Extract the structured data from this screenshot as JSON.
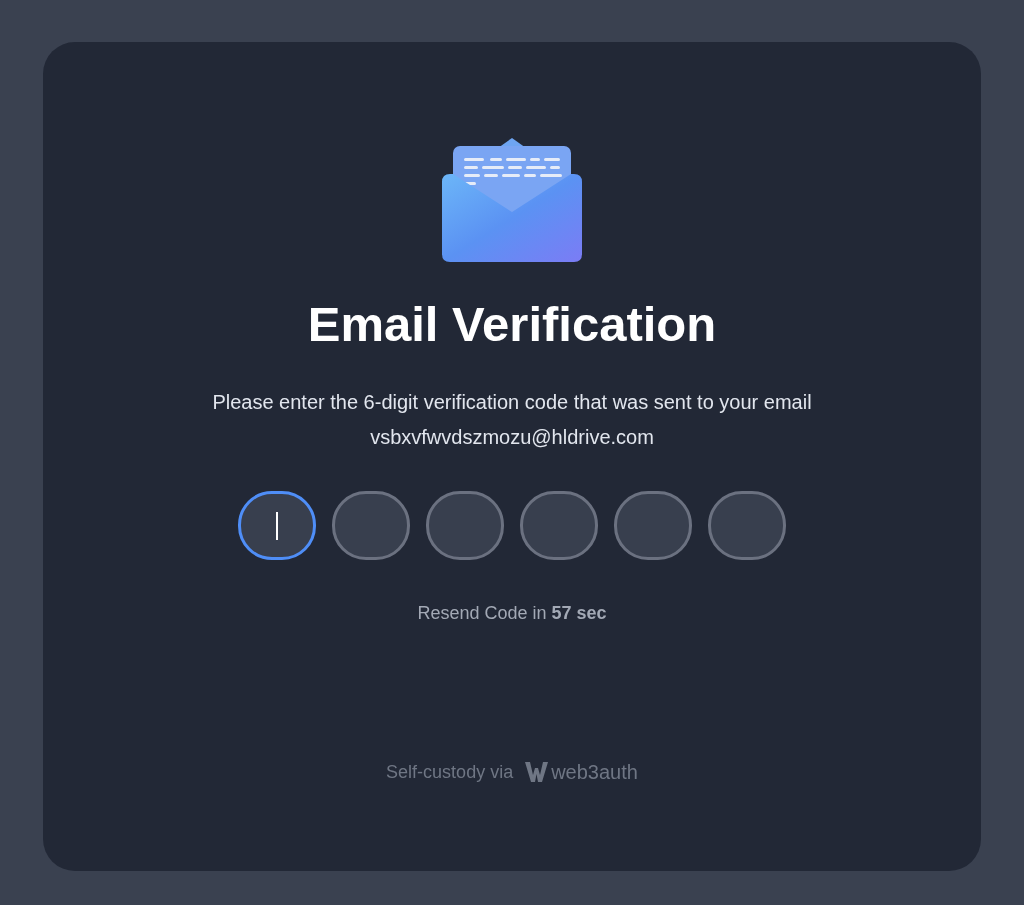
{
  "title": "Email Verification",
  "message": "Please enter the 6-digit verification code that was sent to your email",
  "email": "vsbxvfwvdszmozu@hldrive.com",
  "code_boxes": [
    {
      "focused": true
    },
    {
      "focused": false
    },
    {
      "focused": false
    },
    {
      "focused": false
    },
    {
      "focused": false
    },
    {
      "focused": false
    }
  ],
  "resend": "Resend Code in **57 sec**",
  "footer": {
    "label": "Self-custody via",
    "brand": "web3auth"
  }
}
